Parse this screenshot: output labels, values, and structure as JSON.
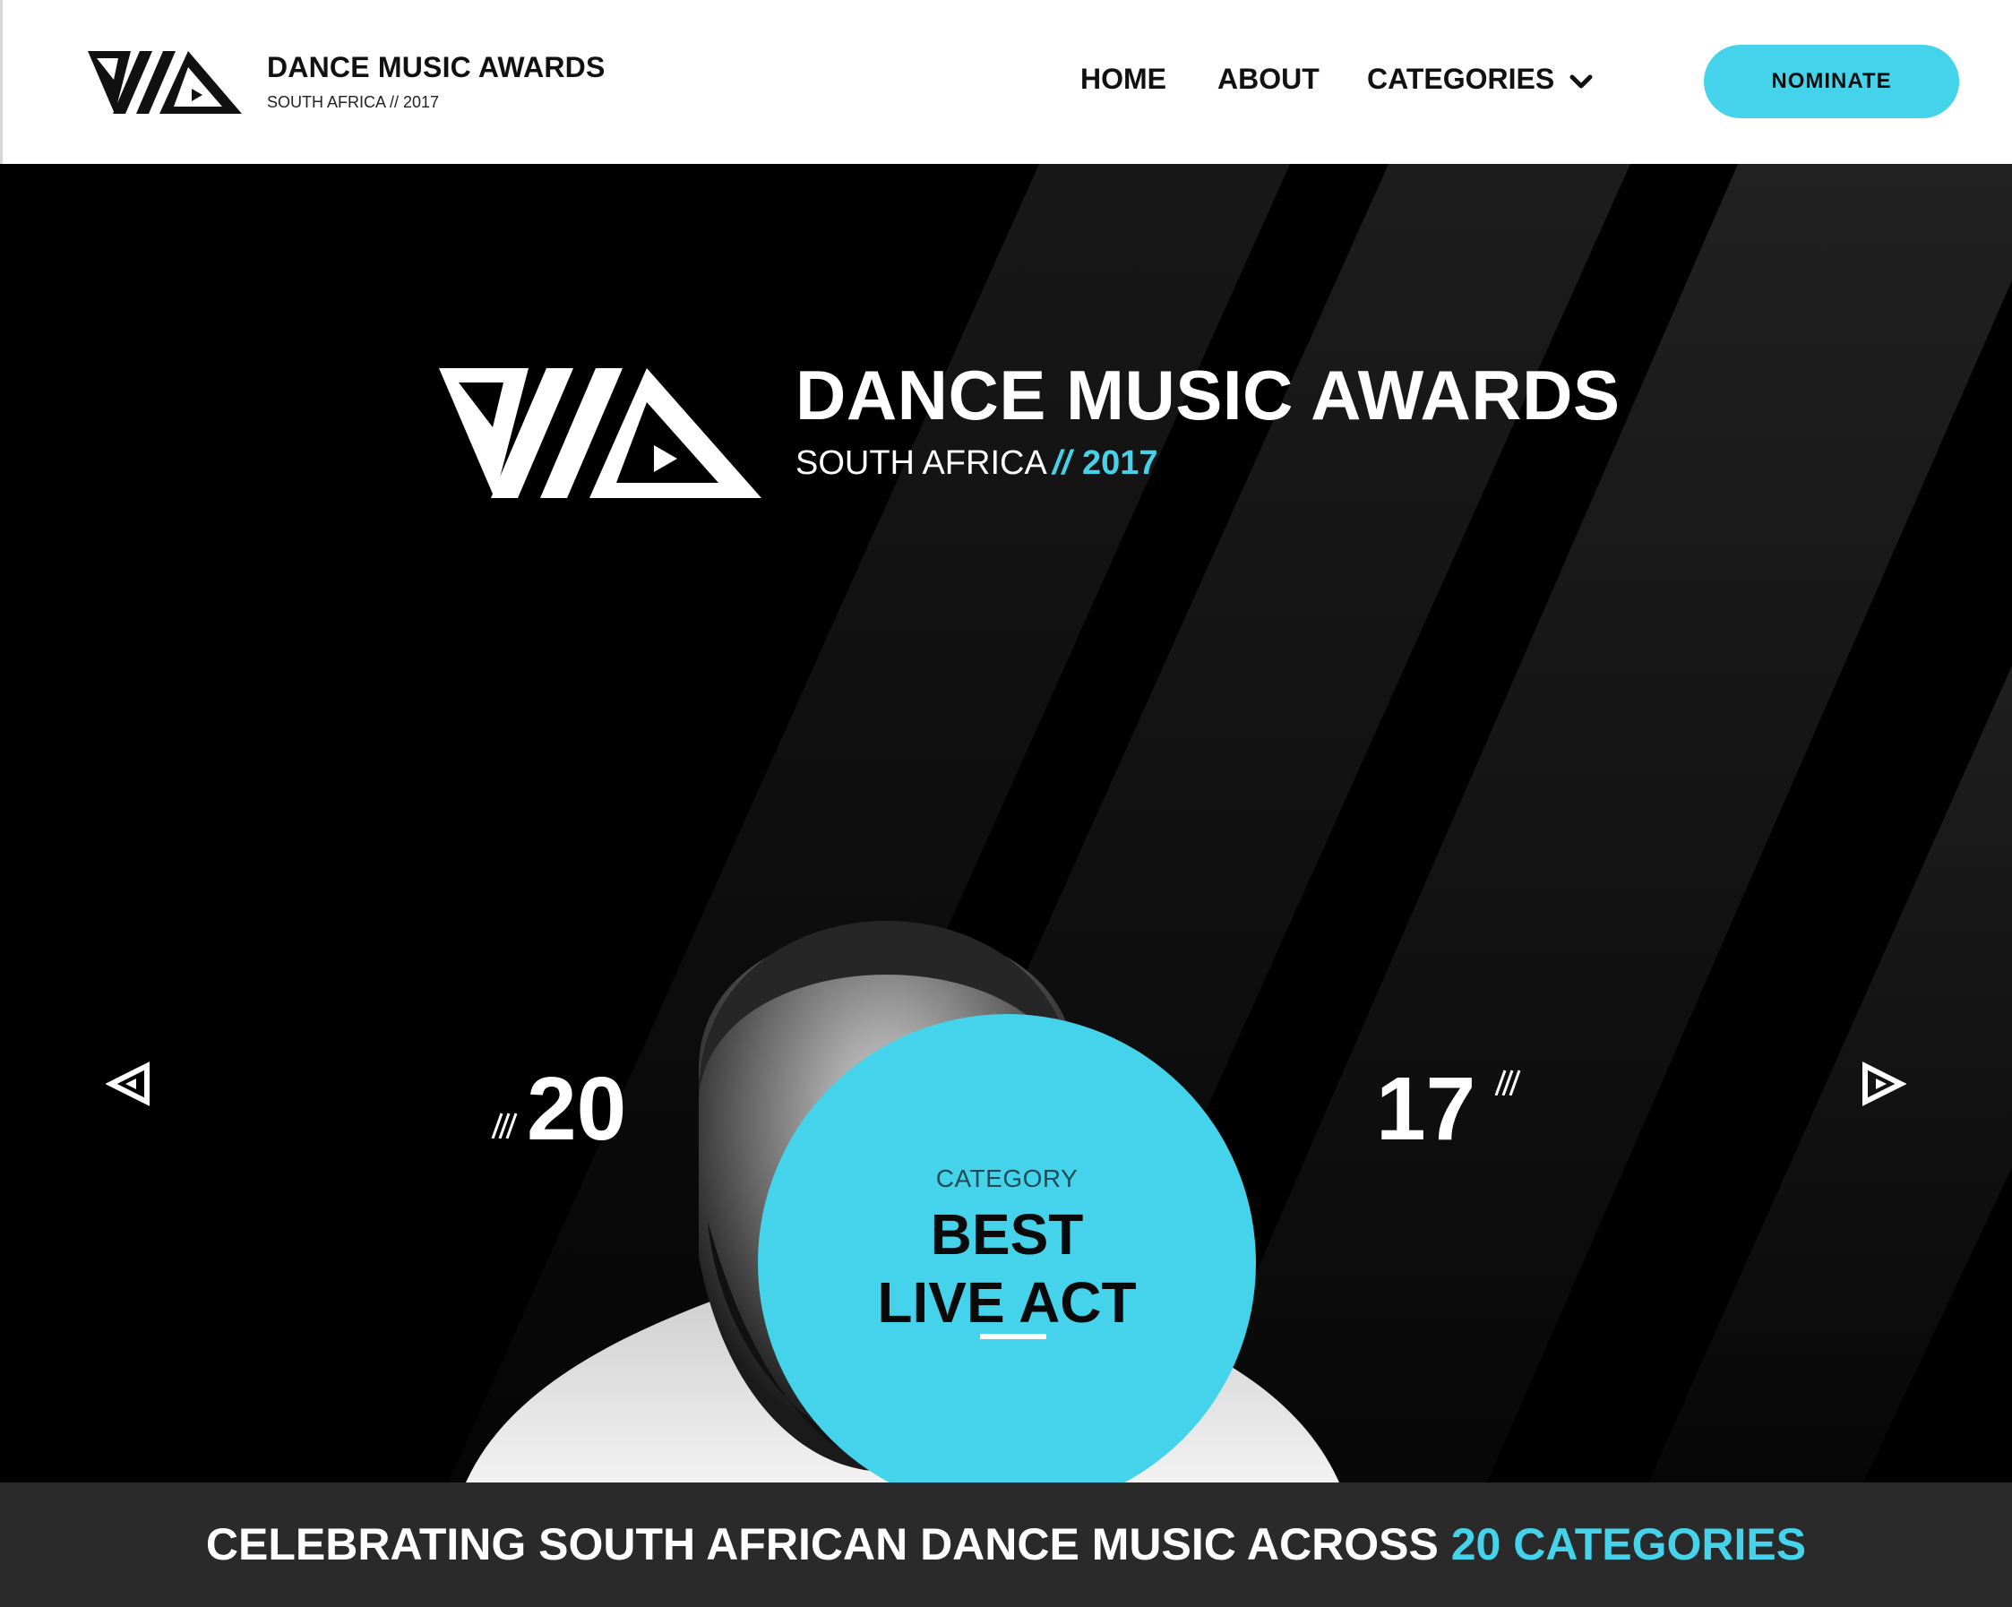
{
  "header": {
    "brand_name": "DANCE MUSIC AWARDS",
    "brand_sub": "SOUTH AFRICA // 2017",
    "nav": {
      "home": "HOME",
      "about": "ABOUT",
      "categories": "CATEGORIES"
    },
    "nominate_label": "NOMINATE"
  },
  "hero": {
    "title": "DANCE MUSIC AWARDS",
    "subtitle_country": "SOUTH AFRICA",
    "subtitle_slash": "//",
    "subtitle_year": "2017",
    "year_left": "20",
    "year_right": "17",
    "category_label": "CATEGORY",
    "category_name": "BEST\nLIVE ACT"
  },
  "band": {
    "text": "CELEBRATING SOUTH AFRICAN DANCE MUSIC ACROSS",
    "highlight": "20 CATEGORIES"
  },
  "colors": {
    "accent": "#44d3ea",
    "hero_bg": "#000000",
    "band_bg": "#2a2a2a",
    "header_bg": "#ffffff"
  },
  "icons": {
    "brand_logo": "triangle-logo-icon",
    "categories_dropdown": "chevron-down-icon",
    "prev": "triangle-left-arrow-icon",
    "next": "triangle-right-arrow-icon"
  }
}
